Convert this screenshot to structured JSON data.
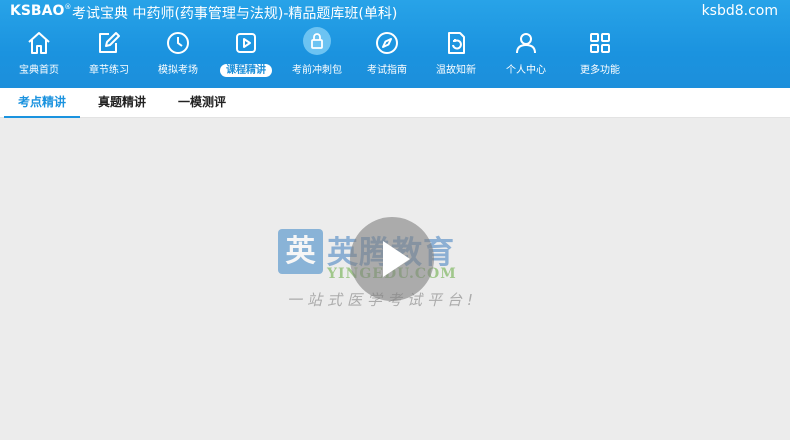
{
  "header": {
    "brand": "KSBAO",
    "brand_mark": "®",
    "title": "考试宝典 中药师(药事管理与法规)-精品题库班(单科)",
    "site": "ksbd8.com"
  },
  "nav": {
    "items": [
      {
        "label": "宝典首页",
        "icon": "home-icon"
      },
      {
        "label": "章节练习",
        "icon": "edit-icon"
      },
      {
        "label": "模拟考场",
        "icon": "clock-icon"
      },
      {
        "label": "课程精讲",
        "icon": "play-square-icon",
        "active": true
      },
      {
        "label": "考前冲刺包",
        "icon": "lock-icon"
      },
      {
        "label": "考试指南",
        "icon": "compass-icon"
      },
      {
        "label": "温故知新",
        "icon": "refresh-doc-icon"
      },
      {
        "label": "个人中心",
        "icon": "user-icon"
      },
      {
        "label": "更多功能",
        "icon": "grid-icon"
      }
    ]
  },
  "subtabs": [
    {
      "label": "考点精讲",
      "active": true
    },
    {
      "label": "真题精讲"
    },
    {
      "label": "一模测评"
    }
  ],
  "video": {
    "watermark_logo_char": "英",
    "watermark_cn": "英腾教育",
    "watermark_en": "YINGEDU.COM",
    "watermark_slogan": "一站式医学考试平台!"
  },
  "colors": {
    "accent": "#1b93df",
    "background": "#ececec"
  }
}
